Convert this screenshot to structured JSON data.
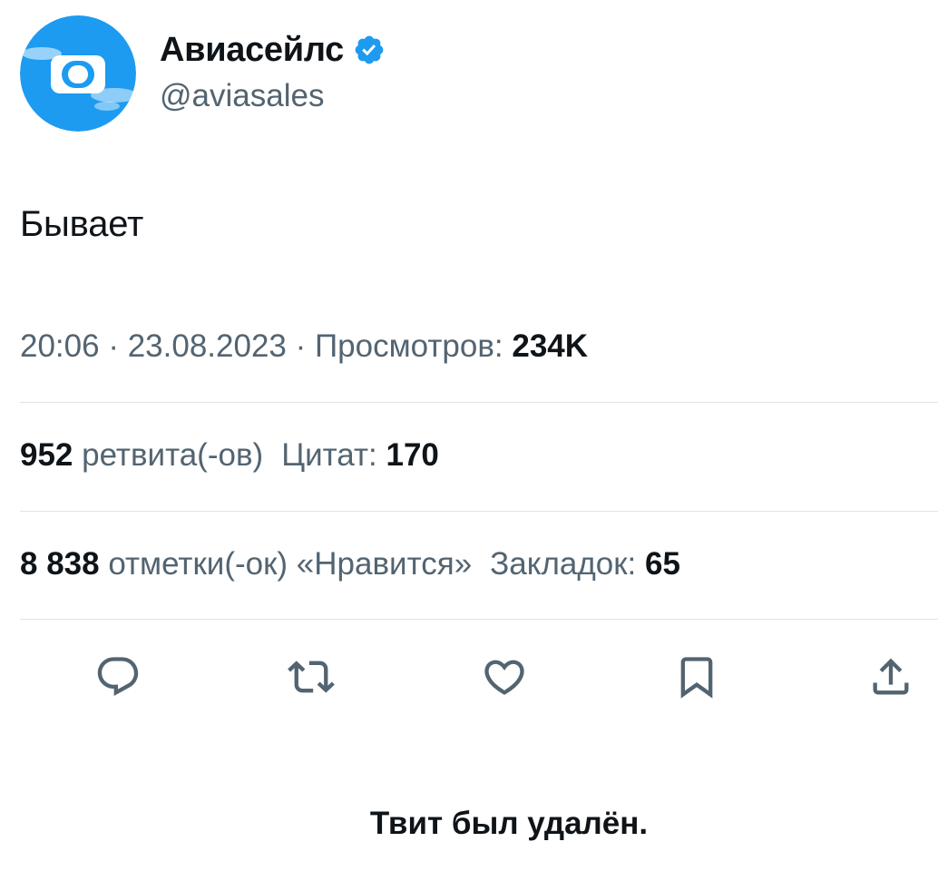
{
  "author": {
    "display_name": "Авиасейлс",
    "handle": "@aviasales",
    "avatar_icon": "aviasales-logo-icon",
    "verified_icon": "verified-badge-icon",
    "brand_color": "#1d9bf0"
  },
  "tweet": {
    "text": "Бывает",
    "time": "20:06",
    "sep1": "·",
    "date": "23.08.2023",
    "sep2": "·",
    "views_label": "Просмотров:",
    "views_value": "234K"
  },
  "stats": {
    "retweets_value": "952",
    "retweets_label": "ретвита(-ов)",
    "quotes_label": "Цитат:",
    "quotes_value": "170",
    "likes_value": "8 838",
    "likes_label": "отметки(-ок) «Нравится»",
    "bookmarks_label": "Закладок:",
    "bookmarks_value": "65"
  },
  "actions": [
    {
      "icon": "reply-icon"
    },
    {
      "icon": "retweet-icon"
    },
    {
      "icon": "like-icon"
    },
    {
      "icon": "bookmark-icon"
    },
    {
      "icon": "share-icon"
    }
  ],
  "footer": {
    "deleted_text": "Твит был удалён."
  },
  "colors": {
    "text_primary": "#0f1419",
    "text_secondary": "#536471",
    "divider": "#dfe4e8",
    "icon": "#536471"
  }
}
